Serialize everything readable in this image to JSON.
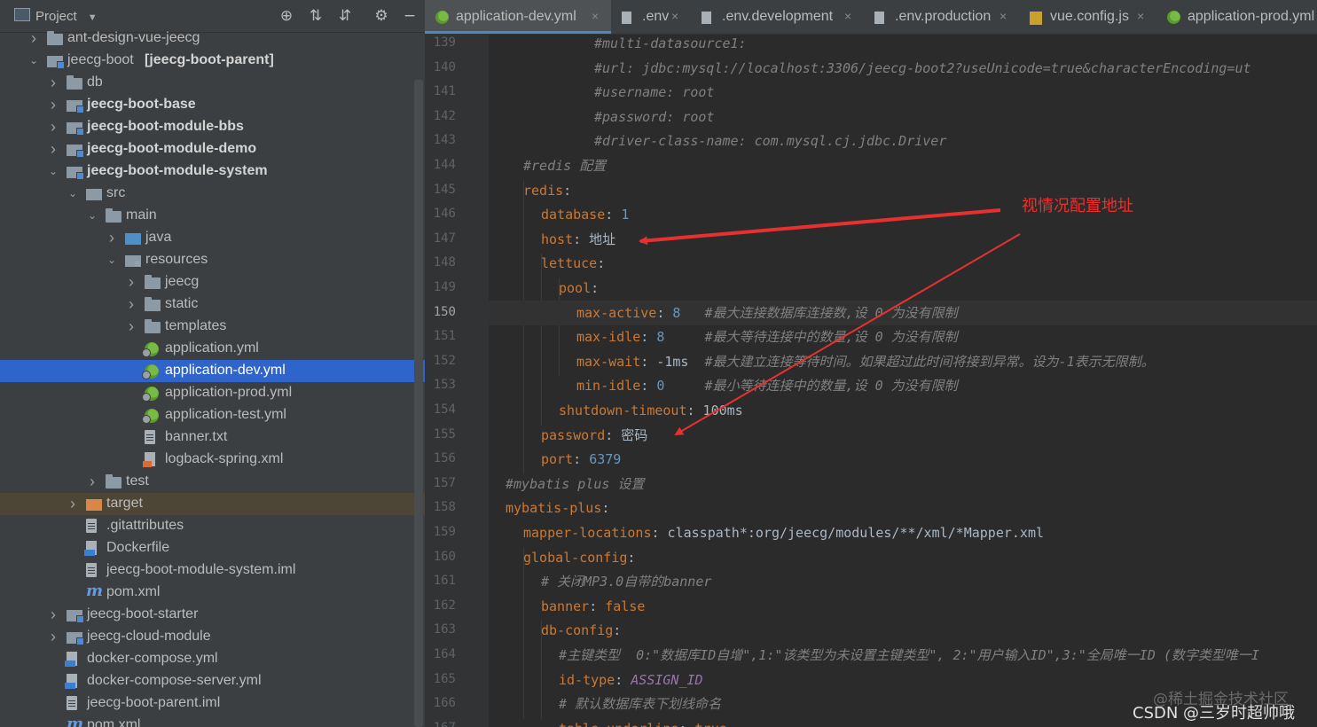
{
  "project_panel": {
    "title": "Project",
    "toolbar_icons": [
      "locate-icon",
      "expand-all-icon",
      "collapse-all-icon",
      "gear-icon",
      "hide-icon"
    ],
    "tree": [
      {
        "label": "ant-design-vue-jeecg",
        "icon": "folder-icon",
        "level": 0,
        "arrow": "right",
        "bold": false
      },
      {
        "label": "jeecg-boot",
        "label_extra": "[jeecg-boot-parent]",
        "icon": "module-icon",
        "level": 0,
        "arrow": "down",
        "bold": false
      },
      {
        "label": "db",
        "icon": "folder-icon",
        "level": 1,
        "arrow": "right",
        "bold": false
      },
      {
        "label": "jeecg-boot-base",
        "icon": "module-icon",
        "level": 1,
        "arrow": "right",
        "bold": true
      },
      {
        "label": "jeecg-boot-module-bbs",
        "icon": "module-icon",
        "level": 1,
        "arrow": "right",
        "bold": true
      },
      {
        "label": "jeecg-boot-module-demo",
        "icon": "module-icon",
        "level": 1,
        "arrow": "right",
        "bold": true
      },
      {
        "label": "jeecg-boot-module-system",
        "icon": "module-icon",
        "level": 1,
        "arrow": "down",
        "bold": true
      },
      {
        "label": "src",
        "icon": "src-folder-icon",
        "level": 2,
        "arrow": "down",
        "bold": false
      },
      {
        "label": "main",
        "icon": "folder-icon",
        "level": 3,
        "arrow": "down",
        "bold": false
      },
      {
        "label": "java",
        "icon": "java-folder-icon",
        "level": 4,
        "arrow": "right",
        "bold": false
      },
      {
        "label": "resources",
        "icon": "resources-folder-icon",
        "level": 4,
        "arrow": "down",
        "bold": false
      },
      {
        "label": "jeecg",
        "icon": "folder-icon",
        "level": 5,
        "arrow": "right",
        "bold": false
      },
      {
        "label": "static",
        "icon": "folder-icon",
        "level": 5,
        "arrow": "right",
        "bold": false
      },
      {
        "label": "templates",
        "icon": "folder-icon",
        "level": 5,
        "arrow": "right",
        "bold": false
      },
      {
        "label": "application.yml",
        "icon": "spring-yml-icon",
        "level": 5,
        "arrow": "",
        "bold": false
      },
      {
        "label": "application-dev.yml",
        "icon": "spring-yml-icon",
        "level": 5,
        "arrow": "",
        "bold": false,
        "selected": true
      },
      {
        "label": "application-prod.yml",
        "icon": "spring-yml-icon",
        "level": 5,
        "arrow": "",
        "bold": false
      },
      {
        "label": "application-test.yml",
        "icon": "spring-yml-icon",
        "level": 5,
        "arrow": "",
        "bold": false
      },
      {
        "label": "banner.txt",
        "icon": "text-file-icon",
        "level": 5,
        "arrow": "",
        "bold": false
      },
      {
        "label": "logback-spring.xml",
        "icon": "xml-file-icon",
        "level": 5,
        "arrow": "",
        "bold": false
      },
      {
        "label": "test",
        "icon": "folder-icon",
        "level": 3,
        "arrow": "right",
        "bold": false
      },
      {
        "label": "target",
        "icon": "target-folder-icon",
        "level": 2,
        "arrow": "right",
        "bold": false,
        "excluded": true
      },
      {
        "label": ".gitattributes",
        "icon": "text-file-icon",
        "level": 2,
        "arrow": "",
        "bold": false
      },
      {
        "label": "Dockerfile",
        "icon": "docker-file-icon",
        "level": 2,
        "arrow": "",
        "bold": false
      },
      {
        "label": "jeecg-boot-module-system.iml",
        "icon": "iml-file-icon",
        "level": 2,
        "arrow": "",
        "bold": false
      },
      {
        "label": "pom.xml",
        "icon": "maven-icon",
        "level": 2,
        "arrow": "",
        "bold": false
      },
      {
        "label": "jeecg-boot-starter",
        "icon": "module-icon",
        "level": 1,
        "arrow": "right",
        "bold": false
      },
      {
        "label": "jeecg-cloud-module",
        "icon": "module-icon",
        "level": 1,
        "arrow": "right",
        "bold": false
      },
      {
        "label": "docker-compose.yml",
        "icon": "docker-file-icon",
        "level": 1,
        "arrow": "",
        "bold": false
      },
      {
        "label": "docker-compose-server.yml",
        "icon": "docker-file-icon",
        "level": 1,
        "arrow": "",
        "bold": false
      },
      {
        "label": "jeecg-boot-parent.iml",
        "icon": "iml-file-icon",
        "level": 1,
        "arrow": "",
        "bold": false
      },
      {
        "label": "pom.xml",
        "icon": "maven-icon",
        "level": 1,
        "arrow": "",
        "bold": false
      }
    ]
  },
  "tabs": [
    {
      "label": "application-dev.yml",
      "icon": "spring-yml-icon",
      "active": true
    },
    {
      "label": ".env",
      "icon": "text-file-icon",
      "active": false
    },
    {
      "label": ".env.development",
      "icon": "text-file-icon",
      "active": false
    },
    {
      "label": ".env.production",
      "icon": "text-file-icon",
      "active": false
    },
    {
      "label": "vue.config.js",
      "icon": "js-file-icon",
      "active": false
    },
    {
      "label": "application-prod.yml",
      "icon": "spring-yml-icon",
      "active": false
    }
  ],
  "editor": {
    "current_line": 150,
    "lines": [
      {
        "n": 139,
        "indent": 10,
        "parts": [
          [
            "cmt",
            "#multi-datasource1:"
          ]
        ]
      },
      {
        "n": 140,
        "indent": 10,
        "parts": [
          [
            "cmt",
            "#url: jdbc:mysql://localhost:3306/jeecg-boot2?useUnicode=true&characterEncoding=ut"
          ]
        ]
      },
      {
        "n": 141,
        "indent": 10,
        "parts": [
          [
            "cmt",
            "#username: root"
          ]
        ]
      },
      {
        "n": 142,
        "indent": 10,
        "parts": [
          [
            "cmt",
            "#password: root"
          ]
        ]
      },
      {
        "n": 143,
        "indent": 10,
        "parts": [
          [
            "cmt",
            "#driver-class-name: com.mysql.cj.jdbc.Driver"
          ]
        ]
      },
      {
        "n": 144,
        "indent": 2,
        "parts": [
          [
            "cmt",
            "#redis 配置"
          ]
        ]
      },
      {
        "n": 145,
        "indent": 2,
        "parts": [
          [
            "key",
            "redis"
          ],
          [
            "str",
            ":"
          ]
        ]
      },
      {
        "n": 146,
        "indent": 4,
        "parts": [
          [
            "key",
            "database"
          ],
          [
            "str",
            ": "
          ],
          [
            "num",
            "1"
          ]
        ]
      },
      {
        "n": 147,
        "indent": 4,
        "parts": [
          [
            "key",
            "host"
          ],
          [
            "str",
            ": 地址"
          ]
        ]
      },
      {
        "n": 148,
        "indent": 4,
        "parts": [
          [
            "key",
            "lettuce"
          ],
          [
            "str",
            ":"
          ]
        ]
      },
      {
        "n": 149,
        "indent": 6,
        "parts": [
          [
            "key",
            "pool"
          ],
          [
            "str",
            ":"
          ]
        ]
      },
      {
        "n": 150,
        "indent": 8,
        "parts": [
          [
            "key",
            "max-active"
          ],
          [
            "str",
            ": "
          ],
          [
            "num",
            "8"
          ],
          [
            "str",
            "   "
          ],
          [
            "cmt",
            "#最大连接数据库连接数,设 0 为没有限制"
          ]
        ]
      },
      {
        "n": 151,
        "indent": 8,
        "parts": [
          [
            "key",
            "max-idle"
          ],
          [
            "str",
            ": "
          ],
          [
            "num",
            "8"
          ],
          [
            "str",
            "     "
          ],
          [
            "cmt",
            "#最大等待连接中的数量,设 0 为没有限制"
          ]
        ]
      },
      {
        "n": 152,
        "indent": 8,
        "parts": [
          [
            "key",
            "max-wait"
          ],
          [
            "str",
            ": -1ms  "
          ],
          [
            "cmt",
            "#最大建立连接等待时间。如果超过此时间将接到异常。设为-1表示无限制。"
          ]
        ]
      },
      {
        "n": 153,
        "indent": 8,
        "parts": [
          [
            "key",
            "min-idle"
          ],
          [
            "str",
            ": "
          ],
          [
            "num",
            "0"
          ],
          [
            "str",
            "     "
          ],
          [
            "cmt",
            "#最小等待连接中的数量,设 0 为没有限制"
          ]
        ]
      },
      {
        "n": 154,
        "indent": 6,
        "parts": [
          [
            "key",
            "shutdown-timeout"
          ],
          [
            "str",
            ": 100ms"
          ]
        ]
      },
      {
        "n": 155,
        "indent": 4,
        "parts": [
          [
            "key",
            "password"
          ],
          [
            "str",
            ": 密码"
          ]
        ]
      },
      {
        "n": 156,
        "indent": 4,
        "parts": [
          [
            "key",
            "port"
          ],
          [
            "str",
            ": "
          ],
          [
            "num",
            "6379"
          ]
        ]
      },
      {
        "n": 157,
        "indent": 0,
        "parts": [
          [
            "cmt",
            "#mybatis plus 设置"
          ]
        ]
      },
      {
        "n": 158,
        "indent": 0,
        "parts": [
          [
            "key",
            "mybatis-plus"
          ],
          [
            "str",
            ":"
          ]
        ]
      },
      {
        "n": 159,
        "indent": 2,
        "parts": [
          [
            "key",
            "mapper-locations"
          ],
          [
            "str",
            ": classpath*:org/jeecg/modules/**/xml/*Mapper.xml"
          ]
        ]
      },
      {
        "n": 160,
        "indent": 2,
        "parts": [
          [
            "key",
            "global-config"
          ],
          [
            "str",
            ":"
          ]
        ]
      },
      {
        "n": 161,
        "indent": 4,
        "parts": [
          [
            "cmt",
            "# 关闭MP3.0自带的banner"
          ]
        ]
      },
      {
        "n": 162,
        "indent": 4,
        "parts": [
          [
            "key",
            "banner"
          ],
          [
            "str",
            ": "
          ],
          [
            "kw",
            "false"
          ]
        ]
      },
      {
        "n": 163,
        "indent": 4,
        "parts": [
          [
            "key",
            "db-config"
          ],
          [
            "str",
            ":"
          ]
        ]
      },
      {
        "n": 164,
        "indent": 6,
        "parts": [
          [
            "cmt",
            "#主键类型  0:\"数据库ID自增\",1:\"该类型为未设置主键类型\", 2:\"用户输入ID\",3:\"全局唯一ID (数字类型唯一I"
          ]
        ]
      },
      {
        "n": 165,
        "indent": 6,
        "parts": [
          [
            "key",
            "id-type"
          ],
          [
            "str",
            ": "
          ],
          [
            "cst",
            "ASSIGN_ID"
          ]
        ]
      },
      {
        "n": 166,
        "indent": 6,
        "parts": [
          [
            "cmt",
            "# 默认数据库表下划线命名"
          ]
        ]
      },
      {
        "n": 167,
        "indent": 6,
        "parts": [
          [
            "key",
            "table-underline"
          ],
          [
            "str",
            ": "
          ],
          [
            "kw",
            "true"
          ]
        ]
      }
    ],
    "fold_markers": [
      143,
      145,
      148,
      149,
      153,
      154,
      156,
      158,
      160,
      163
    ]
  },
  "annotation": {
    "text": "视情况配置地址",
    "color": "#e8312f"
  },
  "watermarks": [
    "@稀土掘金技术社区",
    "CSDN @三岁时超帅哦"
  ],
  "colors": {
    "selection": "#2f65ca",
    "key": "#cc7832",
    "comment": "#808080",
    "number": "#6897bb"
  }
}
